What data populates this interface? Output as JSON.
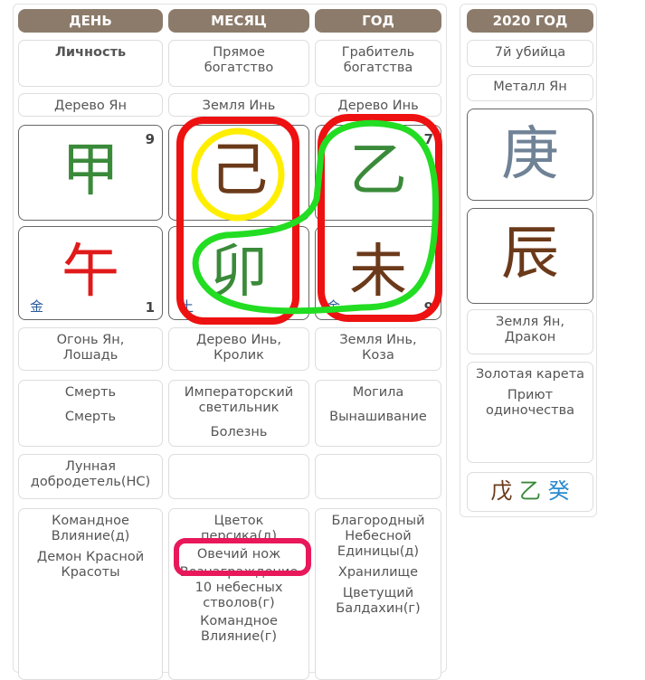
{
  "columns": [
    {
      "header": "ДЕНЬ",
      "ten_god": "Личность",
      "element": "Дерево Ян",
      "stem": "甲",
      "stem_color": "#3a8a3a",
      "stem_num": "9",
      "branch": "午",
      "branch_color": "#e01a1a",
      "branch_element": "金",
      "branch_num": "1",
      "branch_desc": [
        "Огонь Ян,",
        "Лошадь"
      ],
      "stages": [
        "Смерть",
        "Смерть"
      ],
      "special": [
        "Лунная",
        "добродетель(НС)"
      ],
      "stars": [
        "Командное Влияние(д)",
        "Демон Красной Красоты"
      ]
    },
    {
      "header": "МЕСЯЦ",
      "ten_god": "Прямое богатство",
      "element": "Земля Инь",
      "stem": "己",
      "stem_color": "#6b3a1a",
      "stem_num": "",
      "branch": "卯",
      "branch_color": "#3a8a3a",
      "branch_element": "土",
      "branch_num": "",
      "branch_desc": [
        "Дерево Инь,",
        "Кролик"
      ],
      "stages": [
        "Императорский светильник",
        "Болезнь"
      ],
      "special": [],
      "stars": [
        "Цветок персика(д)",
        "Овечий нож",
        "Вознаграждение 10 небесных стволов(г)",
        "Командное Влияние(г)"
      ]
    },
    {
      "header": "ГОД",
      "ten_god": "Грабитель богатства",
      "element": "Дерево Инь",
      "stem": "乙",
      "stem_color": "#3a8a3a",
      "stem_num": "7",
      "branch": "未",
      "branch_color": "#6b3a1a",
      "branch_element": "金",
      "branch_num": "9",
      "branch_desc": [
        "Земля Инь,",
        "Коза"
      ],
      "stages": [
        "Могила",
        "Вынашивание"
      ],
      "special": [],
      "stars": [
        "Благородный Небесной Единицы(д)",
        "Хранилище",
        "Цветущий Балдахин(г)"
      ]
    }
  ],
  "year_panel": {
    "header": "2020 ГОД",
    "ten_god": "7й убийца",
    "element": "Металл Ян",
    "stem": "庚",
    "stem_color": "#6f8296",
    "branch": "辰",
    "branch_color": "#6b3a1a",
    "branch_desc": [
      "Земля Ян,",
      "Дракон"
    ],
    "stars": [
      "Золотая карета",
      "Приют одиночества"
    ],
    "hidden": [
      {
        "ch": "戊",
        "color": "#6b3a1a"
      },
      {
        "ch": "乙",
        "color": "#3a8a3a"
      },
      {
        "ch": "癸",
        "color": "#2a8ad0"
      }
    ]
  },
  "annotation_colors": {
    "red": "#ee1111",
    "yellow": "#ffee00",
    "green": "#22dd22",
    "pink": "#e8185a"
  }
}
